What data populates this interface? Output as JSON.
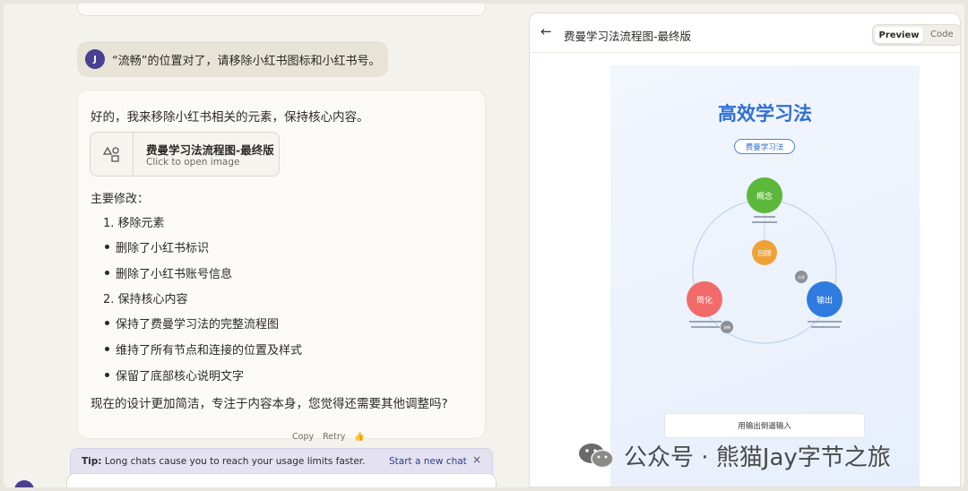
{
  "chat": {
    "user_avatar_initial": "J",
    "user_message": "“流畅”的位置对了，请移除小红书图标和小红书号。",
    "assistant": {
      "intro": "好的，我来移除小红书相关的元素，保持核心内容。",
      "artifact": {
        "title": "费曼学习法流程图-最终版",
        "subtitle": "Click to open image"
      },
      "heading": "主要修改：",
      "items": [
        {
          "kind": "numbered",
          "text": "1. 移除元素"
        },
        {
          "kind": "bullet",
          "text": "删除了小红书标识"
        },
        {
          "kind": "bullet",
          "text": "删除了小红书账号信息"
        },
        {
          "kind": "numbered",
          "text": "2. 保持核心内容"
        },
        {
          "kind": "bullet",
          "text": "保持了费曼学习法的完整流程图"
        },
        {
          "kind": "bullet",
          "text": "维持了所有节点和连接的位置及样式"
        },
        {
          "kind": "bullet",
          "text": "保留了底部核心说明文字"
        }
      ],
      "closing": "现在的设计更加简洁，专注于内容本身，您觉得还需要其他调整吗?",
      "actions": {
        "copy": "Copy",
        "retry": "Retry"
      }
    },
    "tip": {
      "label": "Tip:",
      "text": "Long chats cause you to reach your usage limits faster.",
      "link": "Start a new chat",
      "close": "×"
    }
  },
  "panel": {
    "back": "←",
    "title": "费曼学习法流程图-最终版",
    "tabs": {
      "preview": "Preview",
      "code": "Code"
    },
    "poster": {
      "title": "高效学习法",
      "pill": "费曼学习法",
      "nodes": {
        "top": {
          "label": "概念",
          "color": "#5cb83a"
        },
        "center": {
          "label": "回顾",
          "color": "#eea236"
        },
        "left": {
          "label": "简化",
          "color": "#f26b6b"
        },
        "right": {
          "label": "输出",
          "color": "#2f7be0"
        }
      },
      "badges": {
        "right": "分享",
        "left": "流畅"
      },
      "footer": "用输出倒逼输入"
    }
  },
  "watermark": "公众号 · 熊猫Jay字节之旅"
}
